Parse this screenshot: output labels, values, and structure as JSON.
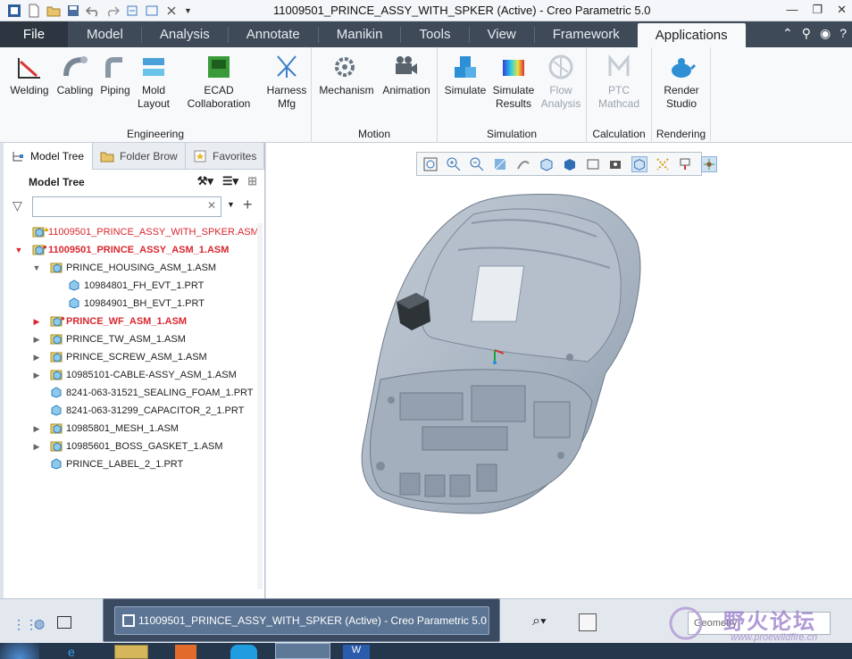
{
  "window": {
    "title": "11009501_PRINCE_ASSY_WITH_SPKER (Active) - Creo Parametric 5.0"
  },
  "tabs": [
    "File",
    "Model",
    "Analysis",
    "Annotate",
    "Manikin",
    "Tools",
    "View",
    "Framework",
    "Applications"
  ],
  "ribbon": {
    "groups": [
      {
        "title": "Engineering",
        "buttons": [
          [
            "Welding",
            ""
          ],
          [
            "Cabling",
            ""
          ],
          [
            "Piping",
            ""
          ],
          [
            "Mold",
            "Layout"
          ],
          [
            "ECAD",
            "Collaboration"
          ],
          [
            "Harness",
            "Mfg"
          ]
        ]
      },
      {
        "title": "Motion",
        "buttons": [
          [
            "Mechanism",
            ""
          ],
          [
            "Animation",
            ""
          ]
        ]
      },
      {
        "title": "Simulation",
        "buttons": [
          [
            "Simulate",
            ""
          ],
          [
            "Simulate",
            "Results"
          ],
          [
            "Flow",
            "Analysis"
          ]
        ]
      },
      {
        "title": "Calculation",
        "buttons": [
          [
            "PTC",
            "Mathcad"
          ]
        ]
      },
      {
        "title": "Rendering",
        "buttons": [
          [
            "Render",
            "Studio"
          ]
        ]
      }
    ]
  },
  "panel": {
    "tabs": [
      "Model Tree",
      "Folder Brow",
      "Favorites"
    ],
    "header": "Model Tree",
    "tree": [
      {
        "label": "11009501_PRINCE_ASSY_WITH_SPKER.ASM",
        "level": 0,
        "toggle": "",
        "red": true,
        "bold": false,
        "warn": "triangle"
      },
      {
        "label": "11009501_PRINCE_ASSY_ASM_1.ASM",
        "level": 0,
        "toggle": "down",
        "red": true,
        "bold": true,
        "warn": "circle"
      },
      {
        "label": "PRINCE_HOUSING_ASM_1.ASM",
        "level": 1,
        "toggle": "down",
        "red": false,
        "bold": false,
        "warn": ""
      },
      {
        "label": "10984801_FH_EVT_1.PRT",
        "level": 2,
        "toggle": "",
        "red": false,
        "bold": false,
        "warn": ""
      },
      {
        "label": "10984901_BH_EVT_1.PRT",
        "level": 2,
        "toggle": "",
        "red": false,
        "bold": false,
        "warn": ""
      },
      {
        "label": "PRINCE_WF_ASM_1.ASM",
        "level": 1,
        "toggle": "right",
        "red": true,
        "bold": true,
        "warn": "circle"
      },
      {
        "label": "PRINCE_TW_ASM_1.ASM",
        "level": 1,
        "toggle": "right",
        "red": false,
        "bold": false,
        "warn": ""
      },
      {
        "label": "PRINCE_SCREW_ASM_1.ASM",
        "level": 1,
        "toggle": "right",
        "red": false,
        "bold": false,
        "warn": ""
      },
      {
        "label": "10985101-CABLE-ASSY_ASM_1.ASM",
        "level": 1,
        "toggle": "right",
        "red": false,
        "bold": false,
        "warn": ""
      },
      {
        "label": "8241-063-31521_SEALING_FOAM_1.PRT",
        "level": 1,
        "toggle": "",
        "red": false,
        "bold": false,
        "warn": ""
      },
      {
        "label": "8241-063-31299_CAPACITOR_2_1.PRT",
        "level": 1,
        "toggle": "",
        "red": false,
        "bold": false,
        "warn": ""
      },
      {
        "label": "10985801_MESH_1.ASM",
        "level": 1,
        "toggle": "right",
        "red": false,
        "bold": false,
        "warn": ""
      },
      {
        "label": "10985601_BOSS_GASKET_1.ASM",
        "level": 1,
        "toggle": "right",
        "red": false,
        "bold": false,
        "warn": ""
      },
      {
        "label": "PRINCE_LABEL_2_1.PRT",
        "level": 1,
        "toggle": "",
        "red": false,
        "bold": false,
        "warn": ""
      }
    ]
  },
  "taskbar_popup": "11009501_PRINCE_ASSY_WITH_SPKER (Active) - Creo Parametric 5.0",
  "status": {
    "filter": "Geometry"
  },
  "watermark": {
    "cn": "野火论坛",
    "url": "www.proewildfire.cn"
  },
  "colors": {
    "tabbar": "#3f4a58",
    "red": "#d9272e",
    "model": "#a9b6c4"
  }
}
